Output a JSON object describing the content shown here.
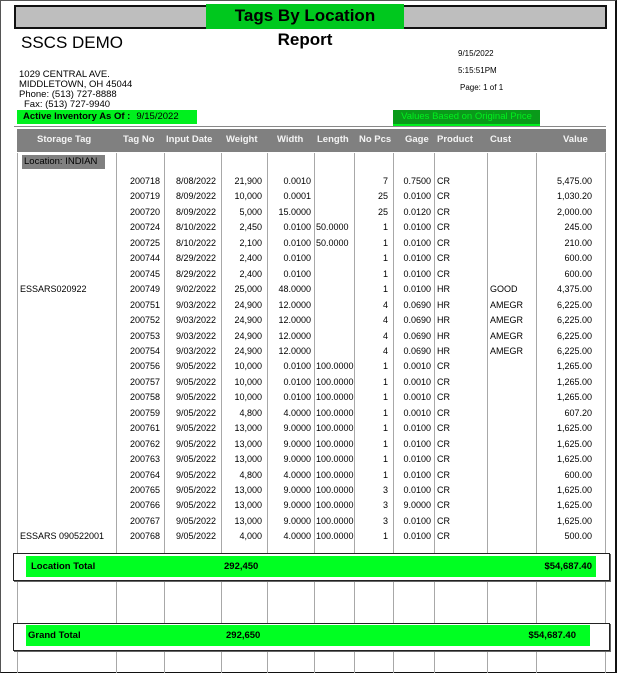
{
  "report": {
    "title": "Tags By Location Report",
    "company": "SSCS DEMO",
    "address_line1": "1029 CENTRAL AVE.",
    "address_line2": "MIDDLETOWN, OH 45044",
    "phone": "Phone: (513) 727-8888",
    "fax": "Fax: (513) 727-9940",
    "print_date": "9/15/2022",
    "print_time": "5:15:51PM",
    "page": "Page: 1 of 1",
    "active_inventory_label": "Active Inventory As Of :",
    "active_inventory_date": "9/15/2022",
    "values_note": "Values Based on Original Price"
  },
  "columns": [
    "Storage Tag",
    "Tag No",
    "Input Date",
    "Weight",
    "Width",
    "Length",
    "No Pcs",
    "Gage",
    "Product",
    "Cust",
    "Value"
  ],
  "location_label": "Location: INDIAN",
  "rows": [
    {
      "storage_tag": "",
      "tag_no": "200718",
      "input_date": "8/08/2022",
      "weight": "21,900",
      "width": "0.0010",
      "length": "",
      "no_pcs": "7",
      "gage": "0.7500",
      "product": "CR",
      "cust": "",
      "value": "5,475.00"
    },
    {
      "storage_tag": "",
      "tag_no": "200719",
      "input_date": "8/09/2022",
      "weight": "10,000",
      "width": "0.0001",
      "length": "",
      "no_pcs": "25",
      "gage": "0.0100",
      "product": "CR",
      "cust": "",
      "value": "1,030.20"
    },
    {
      "storage_tag": "",
      "tag_no": "200720",
      "input_date": "8/09/2022",
      "weight": "5,000",
      "width": "15.0000",
      "length": "",
      "no_pcs": "25",
      "gage": "0.0120",
      "product": "CR",
      "cust": "",
      "value": "2,000.00"
    },
    {
      "storage_tag": "",
      "tag_no": "200724",
      "input_date": "8/10/2022",
      "weight": "2,450",
      "width": "0.0100",
      "length": "50.0000",
      "no_pcs": "1",
      "gage": "0.0100",
      "product": "CR",
      "cust": "",
      "value": "245.00"
    },
    {
      "storage_tag": "",
      "tag_no": "200725",
      "input_date": "8/10/2022",
      "weight": "2,100",
      "width": "0.0100",
      "length": "50.0000",
      "no_pcs": "1",
      "gage": "0.0100",
      "product": "CR",
      "cust": "",
      "value": "210.00"
    },
    {
      "storage_tag": "",
      "tag_no": "200744",
      "input_date": "8/29/2022",
      "weight": "2,400",
      "width": "0.0100",
      "length": "",
      "no_pcs": "1",
      "gage": "0.0100",
      "product": "CR",
      "cust": "",
      "value": "600.00"
    },
    {
      "storage_tag": "",
      "tag_no": "200745",
      "input_date": "8/29/2022",
      "weight": "2,400",
      "width": "0.0100",
      "length": "",
      "no_pcs": "1",
      "gage": "0.0100",
      "product": "CR",
      "cust": "",
      "value": "600.00"
    },
    {
      "storage_tag": "ESSARS020922",
      "tag_no": "200749",
      "input_date": "9/02/2022",
      "weight": "25,000",
      "width": "48.0000",
      "length": "",
      "no_pcs": "1",
      "gage": "0.0100",
      "product": "HR",
      "cust": "GOOD",
      "value": "4,375.00"
    },
    {
      "storage_tag": "",
      "tag_no": "200751",
      "input_date": "9/03/2022",
      "weight": "24,900",
      "width": "12.0000",
      "length": "",
      "no_pcs": "4",
      "gage": "0.0690",
      "product": "HR",
      "cust": "AMEGR",
      "value": "6,225.00"
    },
    {
      "storage_tag": "",
      "tag_no": "200752",
      "input_date": "9/03/2022",
      "weight": "24,900",
      "width": "12.0000",
      "length": "",
      "no_pcs": "4",
      "gage": "0.0690",
      "product": "HR",
      "cust": "AMEGR",
      "value": "6,225.00"
    },
    {
      "storage_tag": "",
      "tag_no": "200753",
      "input_date": "9/03/2022",
      "weight": "24,900",
      "width": "12.0000",
      "length": "",
      "no_pcs": "4",
      "gage": "0.0690",
      "product": "HR",
      "cust": "AMEGR",
      "value": "6,225.00"
    },
    {
      "storage_tag": "",
      "tag_no": "200754",
      "input_date": "9/03/2022",
      "weight": "24,900",
      "width": "12.0000",
      "length": "",
      "no_pcs": "4",
      "gage": "0.0690",
      "product": "HR",
      "cust": "AMEGR",
      "value": "6,225.00"
    },
    {
      "storage_tag": "",
      "tag_no": "200756",
      "input_date": "9/05/2022",
      "weight": "10,000",
      "width": "0.0100",
      "length": "100.0000",
      "no_pcs": "1",
      "gage": "0.0010",
      "product": "CR",
      "cust": "",
      "value": "1,265.00"
    },
    {
      "storage_tag": "",
      "tag_no": "200757",
      "input_date": "9/05/2022",
      "weight": "10,000",
      "width": "0.0100",
      "length": "100.0000",
      "no_pcs": "1",
      "gage": "0.0010",
      "product": "CR",
      "cust": "",
      "value": "1,265.00"
    },
    {
      "storage_tag": "",
      "tag_no": "200758",
      "input_date": "9/05/2022",
      "weight": "10,000",
      "width": "0.0100",
      "length": "100.0000",
      "no_pcs": "1",
      "gage": "0.0010",
      "product": "CR",
      "cust": "",
      "value": "1,265.00"
    },
    {
      "storage_tag": "",
      "tag_no": "200759",
      "input_date": "9/05/2022",
      "weight": "4,800",
      "width": "4.0000",
      "length": "100.0000",
      "no_pcs": "1",
      "gage": "0.0010",
      "product": "CR",
      "cust": "",
      "value": "607.20"
    },
    {
      "storage_tag": "",
      "tag_no": "200761",
      "input_date": "9/05/2022",
      "weight": "13,000",
      "width": "9.0000",
      "length": "100.0000",
      "no_pcs": "1",
      "gage": "0.0100",
      "product": "CR",
      "cust": "",
      "value": "1,625.00"
    },
    {
      "storage_tag": "",
      "tag_no": "200762",
      "input_date": "9/05/2022",
      "weight": "13,000",
      "width": "9.0000",
      "length": "100.0000",
      "no_pcs": "1",
      "gage": "0.0100",
      "product": "CR",
      "cust": "",
      "value": "1,625.00"
    },
    {
      "storage_tag": "",
      "tag_no": "200763",
      "input_date": "9/05/2022",
      "weight": "13,000",
      "width": "9.0000",
      "length": "100.0000",
      "no_pcs": "1",
      "gage": "0.0100",
      "product": "CR",
      "cust": "",
      "value": "1,625.00"
    },
    {
      "storage_tag": "",
      "tag_no": "200764",
      "input_date": "9/05/2022",
      "weight": "4,800",
      "width": "4.0000",
      "length": "100.0000",
      "no_pcs": "1",
      "gage": "0.0100",
      "product": "CR",
      "cust": "",
      "value": "600.00"
    },
    {
      "storage_tag": "",
      "tag_no": "200765",
      "input_date": "9/05/2022",
      "weight": "13,000",
      "width": "9.0000",
      "length": "100.0000",
      "no_pcs": "3",
      "gage": "0.0100",
      "product": "CR",
      "cust": "",
      "value": "1,625.00"
    },
    {
      "storage_tag": "",
      "tag_no": "200766",
      "input_date": "9/05/2022",
      "weight": "13,000",
      "width": "9.0000",
      "length": "100.0000",
      "no_pcs": "3",
      "gage": "9.0000",
      "product": "CR",
      "cust": "",
      "value": "1,625.00"
    },
    {
      "storage_tag": "",
      "tag_no": "200767",
      "input_date": "9/05/2022",
      "weight": "13,000",
      "width": "9.0000",
      "length": "100.0000",
      "no_pcs": "3",
      "gage": "0.0100",
      "product": "CR",
      "cust": "",
      "value": "1,625.00"
    },
    {
      "storage_tag": "ESSARS 090522001",
      "tag_no": "200768",
      "input_date": "9/05/2022",
      "weight": "4,000",
      "width": "4.0000",
      "length": "100.0000",
      "no_pcs": "1",
      "gage": "0.0100",
      "product": "CR",
      "cust": "",
      "value": "500.00"
    }
  ],
  "location_total": {
    "label": "Location Total",
    "weight": "292,450",
    "value": "$54,687.40"
  },
  "grand_total": {
    "label": "Grand Total",
    "weight": "292,650",
    "value": "$54,687.40"
  },
  "colors": {
    "green": "#00ff22",
    "header_gray": "#808080",
    "title_green": "#00c81e"
  }
}
